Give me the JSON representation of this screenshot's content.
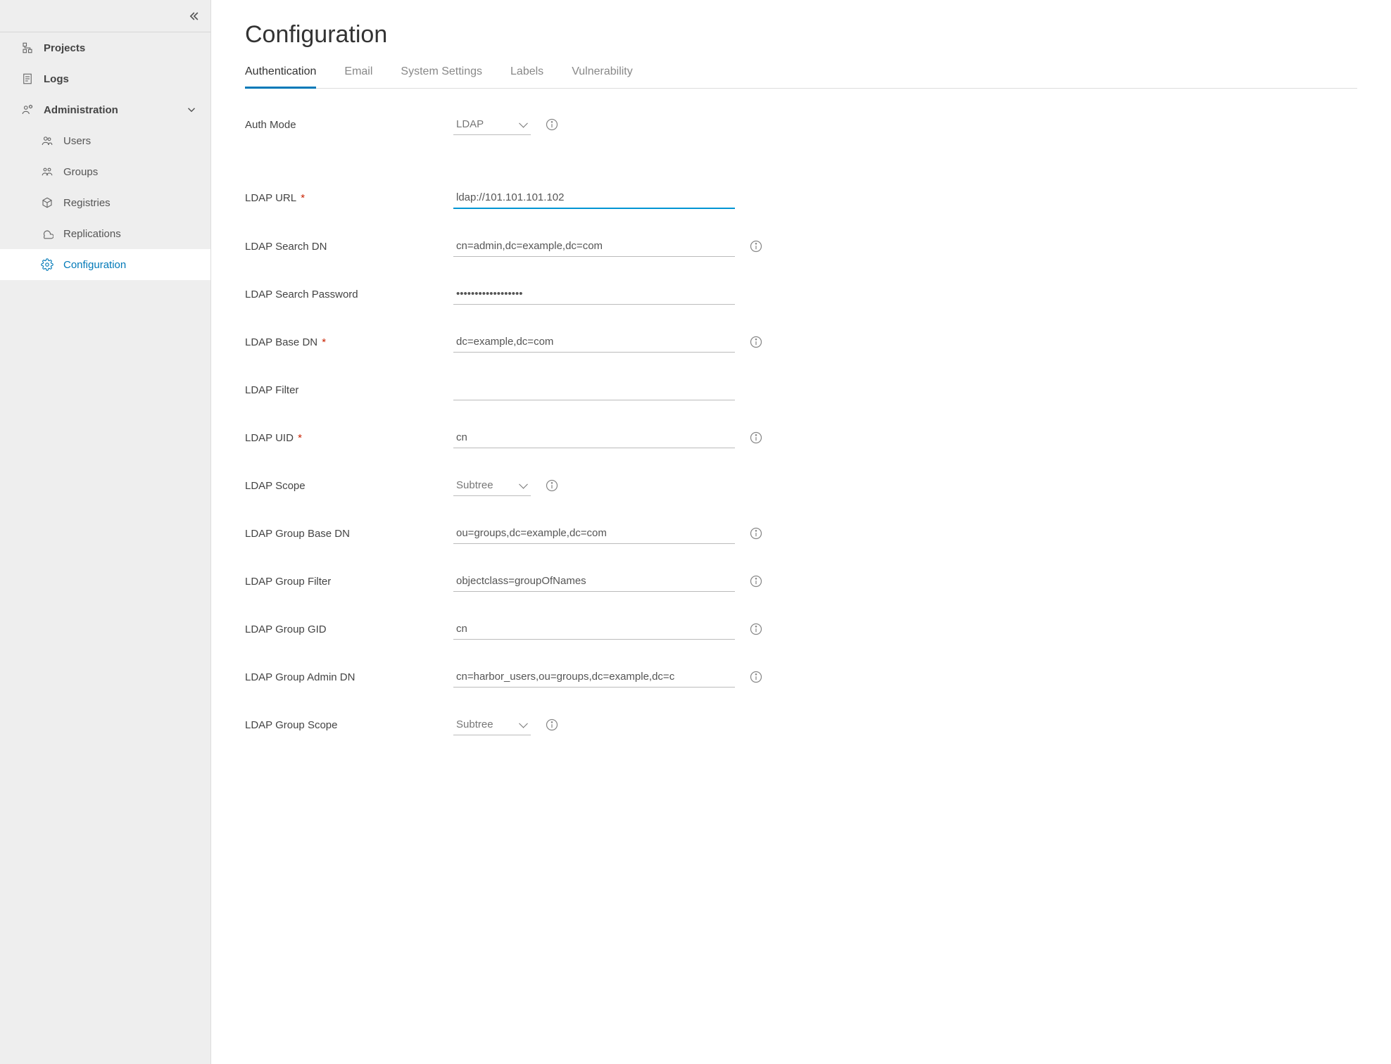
{
  "sidebar": {
    "items": [
      {
        "label": "Projects"
      },
      {
        "label": "Logs"
      },
      {
        "label": "Administration"
      }
    ],
    "admin_children": [
      {
        "label": "Users"
      },
      {
        "label": "Groups"
      },
      {
        "label": "Registries"
      },
      {
        "label": "Replications"
      },
      {
        "label": "Configuration"
      }
    ]
  },
  "main": {
    "title": "Configuration",
    "tabs": [
      {
        "label": "Authentication"
      },
      {
        "label": "Email"
      },
      {
        "label": "System Settings"
      },
      {
        "label": "Labels"
      },
      {
        "label": "Vulnerability"
      }
    ],
    "form": {
      "auth_mode_label": "Auth Mode",
      "auth_mode_value": "LDAP",
      "ldap_url_label": "LDAP URL",
      "ldap_url_value": "ldap://101.101.101.102",
      "ldap_search_dn_label": "LDAP Search DN",
      "ldap_search_dn_value": "cn=admin,dc=example,dc=com",
      "ldap_search_pw_label": "LDAP Search Password",
      "ldap_search_pw_value": "••••••••••••••••••",
      "ldap_base_dn_label": "LDAP Base DN",
      "ldap_base_dn_value": "dc=example,dc=com",
      "ldap_filter_label": "LDAP Filter",
      "ldap_filter_value": "",
      "ldap_uid_label": "LDAP UID",
      "ldap_uid_value": "cn",
      "ldap_scope_label": "LDAP Scope",
      "ldap_scope_value": "Subtree",
      "ldap_group_base_dn_label": "LDAP Group Base DN",
      "ldap_group_base_dn_value": "ou=groups,dc=example,dc=com",
      "ldap_group_filter_label": "LDAP Group Filter",
      "ldap_group_filter_value": "objectclass=groupOfNames",
      "ldap_group_gid_label": "LDAP Group GID",
      "ldap_group_gid_value": "cn",
      "ldap_group_admin_dn_label": "LDAP Group Admin DN",
      "ldap_group_admin_dn_value": "cn=harbor_users,ou=groups,dc=example,dc=c",
      "ldap_group_scope_label": "LDAP Group Scope",
      "ldap_group_scope_value": "Subtree"
    }
  }
}
